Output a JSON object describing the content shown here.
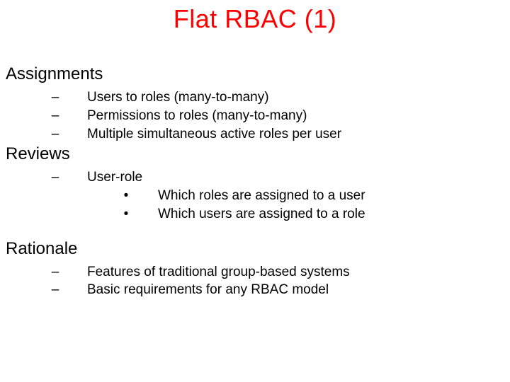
{
  "title": "Flat RBAC (1)",
  "glyphs": {
    "dash": "–",
    "dot": "•"
  },
  "sections": [
    {
      "heading": "Assignments",
      "items": [
        {
          "text": "Users to roles (many-to-many)"
        },
        {
          "text": "Permissions to roles (many-to-many)"
        },
        {
          "text": "Multiple simultaneous active roles per user"
        }
      ]
    },
    {
      "heading": "Reviews",
      "items": [
        {
          "text": "User-role",
          "sub": [
            {
              "text": "Which roles are assigned to a user"
            },
            {
              "text": "Which users are assigned to a role"
            }
          ]
        }
      ]
    },
    {
      "heading": "Rationale",
      "items": [
        {
          "text": "Features of traditional group-based systems"
        },
        {
          "text": "Basic requirements for any RBAC model"
        }
      ]
    }
  ]
}
